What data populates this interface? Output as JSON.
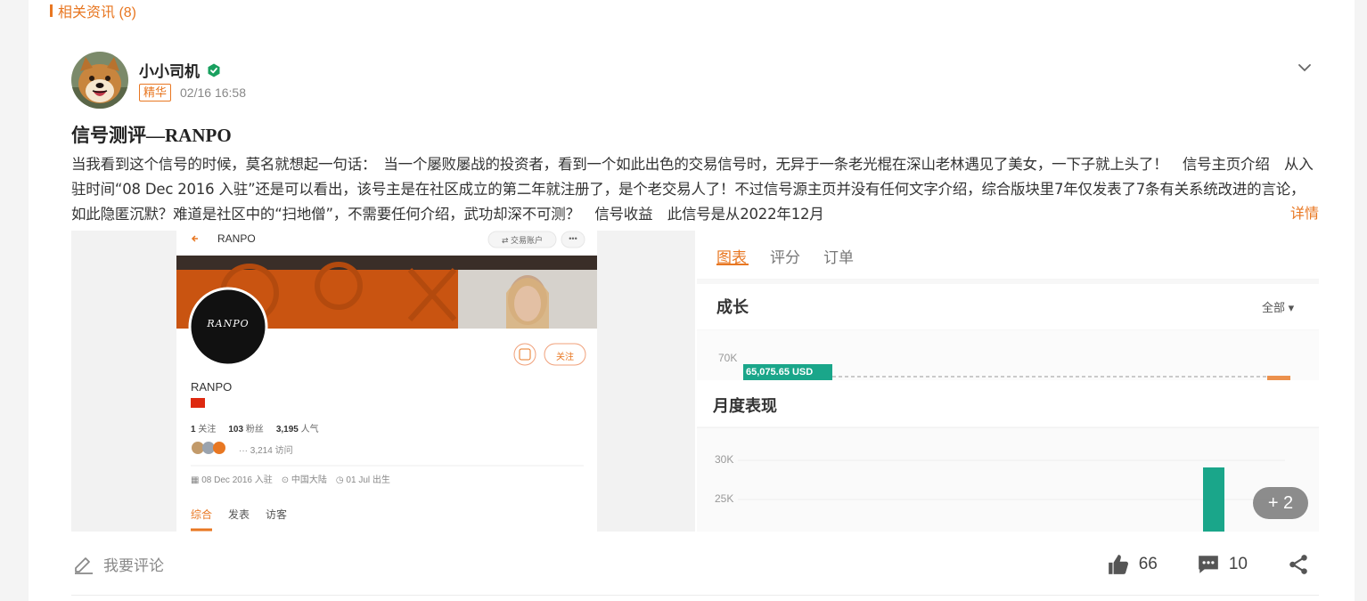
{
  "section": {
    "title": "相关资讯 (8)"
  },
  "post": {
    "author": "小小司机",
    "badge": "精华",
    "timestamp": "02/16 16:58",
    "title": "信号测评—RANPO",
    "body": "当我看到这个信号的时候，莫名就想起一句话：　当一个屡败屡战的投资者，看到一个如此出色的交易信号时，无异于一条老光棍在深山老林遇见了美女，一下子就上头了！　信号主页介绍　从入驻时间“08 Dec 2016 入驻”还是可以看出，该号主是在社区成立的第二年就注册了，是个老交易人了！不过信号源主页并没有任何文字介绍，综合版块里7年仅发表了7条有关系统改进的言论，如此隐匿沉默？难道是社区中的“扫地僧”，不需要任何介绍，武功却深不可测？　信号收益　此信号是从2022年12月",
    "more_label": "详情",
    "extra_images": "+ 2",
    "comment_label": "我要评论",
    "likes": "66",
    "comments": "10"
  },
  "image_left": {
    "back_title": "RANPO",
    "account_btn": "⇄ 交易账户",
    "more_btn": "•••",
    "logo_text": "RANPO",
    "follow_btn": "关注",
    "name": "RANPO",
    "stats": [
      {
        "value": "1",
        "label": "关注"
      },
      {
        "value": "103",
        "label": "粉丝"
      },
      {
        "value": "3,195",
        "label": "人气"
      }
    ],
    "visits": "··· 3,214 访问",
    "joined": "08 Dec 2016 入驻",
    "location": "中国大陆",
    "birthday": "01 Jul 出生",
    "tabs": [
      "综合",
      "发表",
      "访客"
    ]
  },
  "image_right": {
    "tabs": [
      "图表",
      "评分",
      "订单"
    ],
    "growth_title": "成长",
    "range_label": "全部 ▾",
    "growth_tick": "70K",
    "growth_value": "65,075.65 USD",
    "monthly_title": "月度表现",
    "monthly_ticks": [
      "30K",
      "25K"
    ]
  },
  "colors": {
    "accent": "#e87722",
    "verified": "#19a05f",
    "growth_tag": "#1aa68a",
    "bar": "#1aa68a"
  }
}
